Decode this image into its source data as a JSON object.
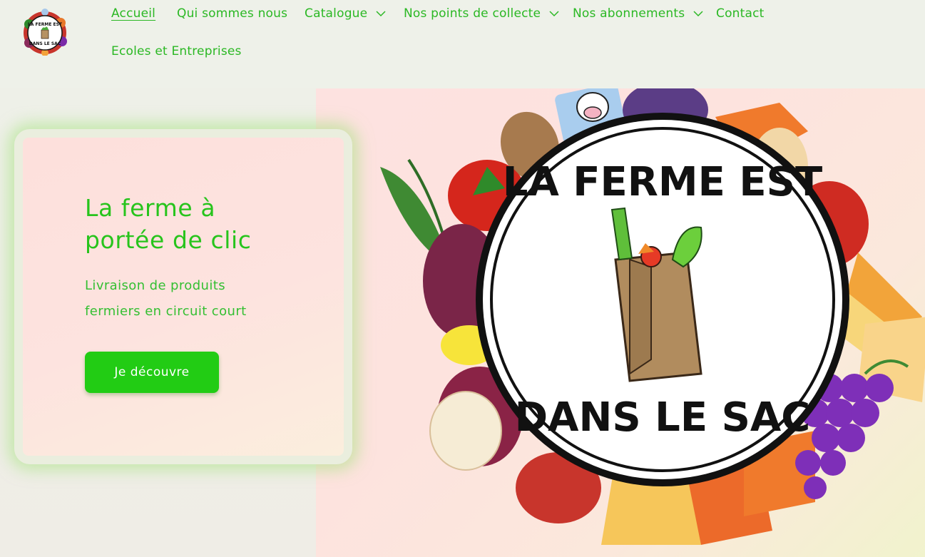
{
  "brand": {
    "logo_alt": "La Ferme est dans le sac",
    "logo_text_top": "LA FERME EST",
    "logo_text_bottom": "DANS LE SAC"
  },
  "nav": {
    "items": [
      {
        "label": "Accueil",
        "active": true,
        "dropdown": false
      },
      {
        "label": "Qui sommes nous",
        "active": false,
        "dropdown": false
      },
      {
        "label": "Catalogue",
        "active": false,
        "dropdown": true
      },
      {
        "label": "Nos points de collecte",
        "active": false,
        "dropdown": true
      },
      {
        "label": "Nos abonnements",
        "active": false,
        "dropdown": true
      },
      {
        "label": "Contact",
        "active": false,
        "dropdown": false
      },
      {
        "label": "Ecoles et Entreprises",
        "active": false,
        "dropdown": false
      }
    ]
  },
  "hero": {
    "title_line1": "La ferme à",
    "title_line2": "portée de clic",
    "subtitle_line1": "Livraison de produits",
    "subtitle_line2": "fermiers en circuit court",
    "cta_label": "Je découvre",
    "badge_top": "LA FERME EST",
    "badge_bottom": "DANS LE SAC"
  },
  "colors": {
    "accent": "#22cc14",
    "nav_text": "#2bb824",
    "background": "#eef0e8"
  }
}
